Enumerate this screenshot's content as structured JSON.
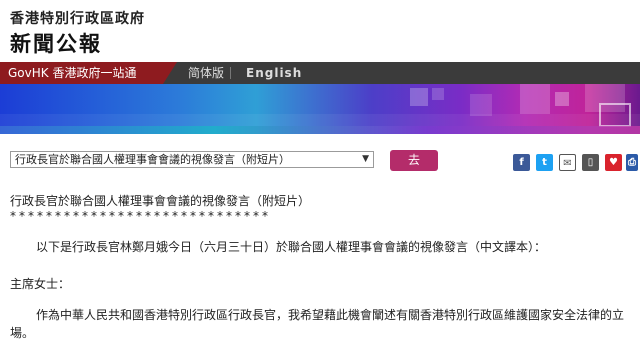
{
  "header": {
    "org": "香港特別行政區政府",
    "title": "新聞公報"
  },
  "nav": {
    "govhk": "GovHK 香港政府一站通",
    "lang_simplified": "简体版",
    "lang_english": "English"
  },
  "toolbar": {
    "select_value": "行政長官於聯合國人權理事會會議的視像發言（附短片）",
    "go_label": "去"
  },
  "share": {
    "icons": [
      "facebook-icon",
      "twitter-icon",
      "email-icon",
      "mobile-icon",
      "bookmark-icon",
      "print-icon"
    ],
    "colors": [
      "#3b5998",
      "#1da1f2",
      "#555555",
      "#555555",
      "#d9232d",
      "#2b5aa8"
    ]
  },
  "article": {
    "title": "行政長官於聯合國人權理事會會議的視像發言（附短片）",
    "stars": "*****************************",
    "intro": "以下是行政長官林鄭月娥今日（六月三十日）於聯合國人權理事會會議的視像發言（中文譯本）：",
    "salutation": "主席女士：",
    "para1": "作為中華人民共和國香港特別行政區行政長官，我希望藉此機會闡述有關香港特別行政區維護國家安全法律的立場。"
  }
}
